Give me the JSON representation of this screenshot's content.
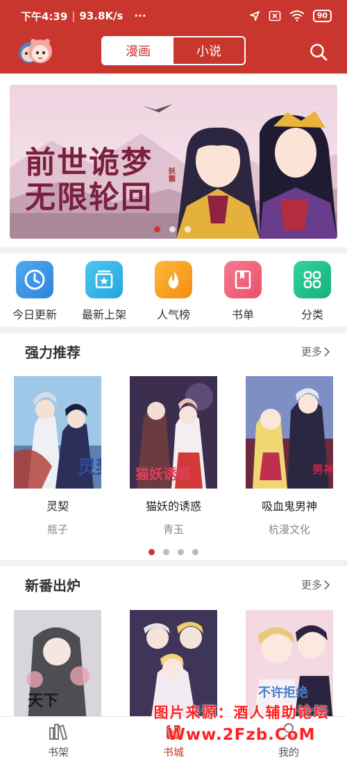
{
  "status_bar": {
    "time": "下午4:39",
    "speed": "93.8K/s",
    "more": "···",
    "battery": "90"
  },
  "header": {
    "tabs": [
      {
        "label": "漫画",
        "active": true
      },
      {
        "label": "小说",
        "active": false
      }
    ]
  },
  "banner": {
    "title_line1": "前世诡梦",
    "title_line2": "无限轮回",
    "tag": "妖靓",
    "slide_count": 3,
    "active_slide": 0
  },
  "categories": [
    {
      "label": "今日更新",
      "icon": "clock-icon",
      "color": "#3a9be8"
    },
    {
      "label": "最新上架",
      "icon": "star-box-icon",
      "color": "#2fb6e6"
    },
    {
      "label": "人气榜",
      "icon": "flame-icon",
      "color": "#f7a21c"
    },
    {
      "label": "书单",
      "icon": "bookmark-book-icon",
      "color": "#f0607a"
    },
    {
      "label": "分类",
      "icon": "grid-icon",
      "color": "#23c48e"
    }
  ],
  "sections": [
    {
      "title": "强力推荐",
      "more": "更多",
      "books": [
        {
          "title": "灵契",
          "author": "瓶子"
        },
        {
          "title": "猫妖的诱惑",
          "author": "青玉"
        },
        {
          "title": "吸血鬼男神",
          "author": "杭漫文化"
        }
      ],
      "page_count": 4,
      "active_page": 0
    },
    {
      "title": "新番出炉",
      "more": "更多",
      "books": [
        {
          "title": "",
          "author": ""
        },
        {
          "title": "",
          "author": ""
        },
        {
          "title": "",
          "author": ""
        }
      ]
    }
  ],
  "bottom_nav": [
    {
      "label": "书架",
      "icon": "bookshelf-icon",
      "active": false
    },
    {
      "label": "书城",
      "icon": "bookstore-icon",
      "active": true
    },
    {
      "label": "我的",
      "icon": "profile-icon",
      "active": false
    }
  ],
  "watermark": {
    "line1": "图片来源：酒人辅助论坛",
    "line2": "Www.2Fzb.CoM"
  },
  "colors": {
    "accent": "#c8362d"
  }
}
